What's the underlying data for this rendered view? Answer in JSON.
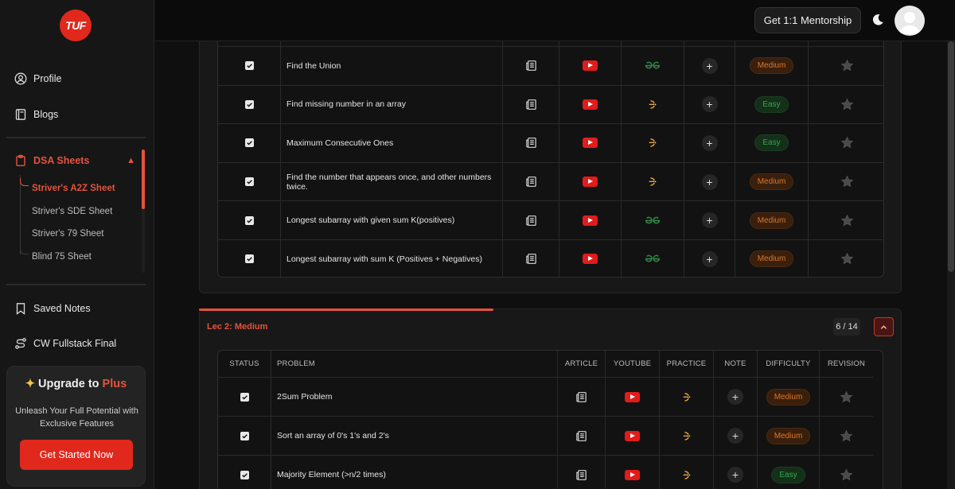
{
  "brand": {
    "logo_text": "TUF"
  },
  "sidebar": {
    "items": [
      {
        "label": "Profile"
      },
      {
        "label": "Blogs"
      }
    ],
    "dsa": {
      "label": "DSA Sheets",
      "subitems": [
        {
          "label": "Striver's A2Z Sheet",
          "active": true
        },
        {
          "label": "Striver's SDE Sheet"
        },
        {
          "label": "Striver's 79 Sheet"
        },
        {
          "label": "Blind 75 Sheet"
        }
      ]
    },
    "bottom_items": [
      {
        "label": "Saved Notes"
      },
      {
        "label": "CW Fullstack Final"
      }
    ],
    "upgrade": {
      "title_prefix": "Upgrade to ",
      "title_plus": "Plus",
      "description": "Unleash Your Full Potential with Exclusive Features",
      "cta": "Get Started Now"
    }
  },
  "topbar": {
    "mentorship_label": "Get 1:1 Mentorship"
  },
  "section1": {
    "rows": [
      {
        "problem": "Find the Union",
        "practice": "gfg",
        "difficulty": "Medium"
      },
      {
        "problem": "Find missing number in an array",
        "practice": "codingninjas",
        "difficulty": "Easy"
      },
      {
        "problem": "Maximum Consecutive Ones",
        "practice": "codingninjas",
        "difficulty": "Easy"
      },
      {
        "problem": "Find the number that appears once, and other numbers twice.",
        "practice": "codingninjas",
        "difficulty": "Medium"
      },
      {
        "problem": "Longest subarray with given sum K(positives)",
        "practice": "gfg",
        "difficulty": "Medium"
      },
      {
        "problem": "Longest subarray with sum K (Positives + Negatives)",
        "practice": "gfg",
        "difficulty": "Medium"
      }
    ]
  },
  "section2": {
    "title": "Lec 2: Medium",
    "count": "6 / 14",
    "headers": [
      "STATUS",
      "PROBLEM",
      "ARTICLE",
      "YOUTUBE",
      "PRACTICE",
      "NOTE",
      "DIFFICULTY",
      "REVISION"
    ],
    "rows": [
      {
        "problem": "2Sum Problem",
        "practice": "codingninjas",
        "difficulty": "Medium"
      },
      {
        "problem": "Sort an array of 0's 1's and 2's",
        "practice": "codingninjas",
        "difficulty": "Medium"
      },
      {
        "problem": "Majority Element (>n/2 times)",
        "practice": "codingninjas",
        "difficulty": "Easy"
      }
    ]
  },
  "colors": {
    "accent": "#e5533d",
    "brand_red": "#e0281c",
    "medium": "#d9782c",
    "easy": "#34a851",
    "gfg_green": "#2f8d46"
  }
}
